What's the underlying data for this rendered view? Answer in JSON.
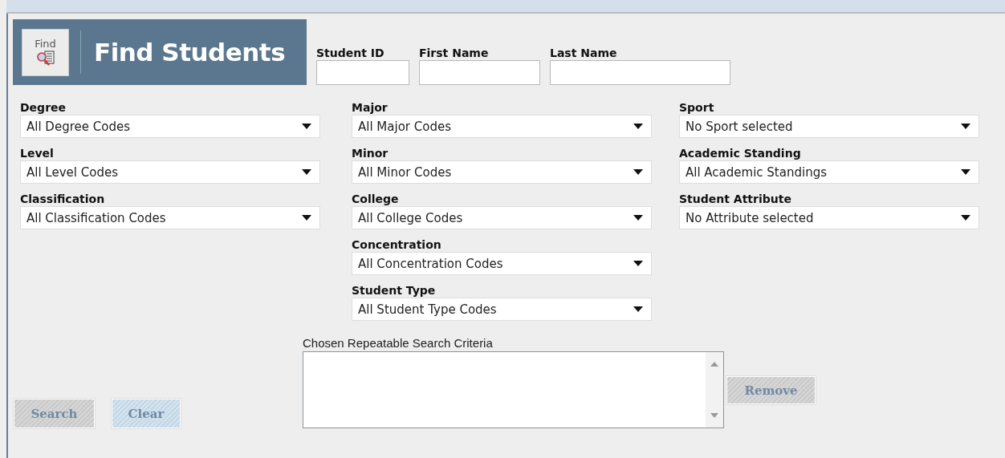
{
  "header": {
    "icon_label": "Find",
    "title": "Find Students"
  },
  "name_fields": [
    {
      "label": "Student ID"
    },
    {
      "label": "First Name"
    },
    {
      "label": "Last Name"
    }
  ],
  "filter_columns": [
    [
      {
        "label": "Degree",
        "value": "All Degree Codes"
      },
      {
        "label": "Level",
        "value": "All Level Codes"
      },
      {
        "label": "Classification",
        "value": "All Classification Codes"
      }
    ],
    [
      {
        "label": "Major",
        "value": "All Major Codes"
      },
      {
        "label": "Minor",
        "value": "All Minor Codes"
      },
      {
        "label": "College",
        "value": "All College Codes"
      },
      {
        "label": "Concentration",
        "value": "All Concentration Codes"
      },
      {
        "label": "Student Type",
        "value": "All Student Type Codes"
      }
    ],
    [
      {
        "label": "Sport",
        "value": "No Sport selected"
      },
      {
        "label": "Academic Standing",
        "value": "All Academic Standings"
      },
      {
        "label": "Student Attribute",
        "value": "No Attribute selected"
      }
    ]
  ],
  "criteria": {
    "label": "Chosen Repeatable Search Criteria"
  },
  "action_buttons": [
    {
      "label": "Search",
      "disabled": true
    },
    {
      "label": "Clear",
      "disabled": true
    }
  ],
  "remove_button": {
    "label": "Remove",
    "disabled": true
  }
}
